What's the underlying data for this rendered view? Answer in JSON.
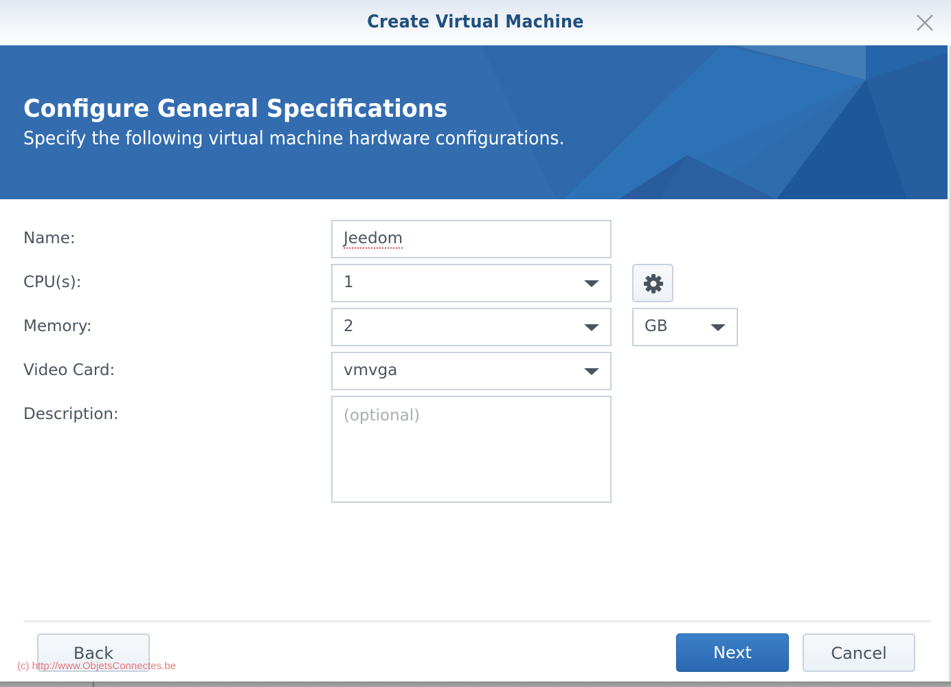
{
  "window": {
    "title": "Create Virtual Machine",
    "close_icon": "close-icon"
  },
  "banner": {
    "heading": "Configure General Specifications",
    "subheading": "Specify the following virtual machine hardware configurations."
  },
  "form": {
    "name": {
      "label": "Name:",
      "value": "Jeedom"
    },
    "cpus": {
      "label": "CPU(s):",
      "value": "1",
      "settings_icon": "gear-icon"
    },
    "memory": {
      "label": "Memory:",
      "value": "2",
      "unit": "GB"
    },
    "video_card": {
      "label": "Video Card:",
      "value": "vmvga"
    },
    "description": {
      "label": "Description:",
      "value": "",
      "placeholder": "(optional)"
    }
  },
  "footer": {
    "back_label": "Back",
    "next_label": "Next",
    "cancel_label": "Cancel"
  },
  "watermark": "(c) http://www.ObjetsConnectes.be",
  "colors": {
    "title": "#1f4f7e",
    "banner": "#336db0",
    "primary_button": "#2f6fb8",
    "field_border": "#c7d2de",
    "text": "#4a5461"
  }
}
